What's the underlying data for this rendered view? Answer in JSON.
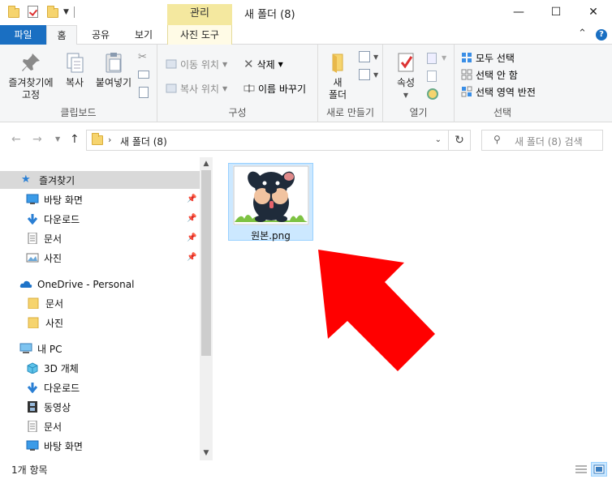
{
  "titlebar": {
    "manage_tab": "관리",
    "window_title": "새 폴더 (8)",
    "minimize": "—",
    "maximize": "☐",
    "close": "✕"
  },
  "tabs": {
    "file": "파일",
    "home": "홈",
    "share": "공유",
    "view": "보기",
    "picture_tools": "사진 도구"
  },
  "ribbon": {
    "clipboard": {
      "pin_label": "즐겨찾기에\n고정",
      "pin_l1": "즐겨찾기에",
      "pin_l2": "고정",
      "copy": "복사",
      "paste": "붙여넣기",
      "group": "클립보드"
    },
    "organize": {
      "move_to": "이동 위치",
      "copy_to": "복사 위치",
      "delete": "삭제",
      "rename": "이름 바꾸기",
      "group": "구성"
    },
    "new": {
      "new_folder_l1": "새",
      "new_folder_l2": "폴더",
      "group": "새로 만들기"
    },
    "open": {
      "properties": "속성",
      "group": "열기"
    },
    "select": {
      "select_all": "모두 선택",
      "select_none": "선택 안 함",
      "invert": "선택 영역 반전",
      "group": "선택"
    }
  },
  "address": {
    "path": "새 폴더 (8)",
    "search_placeholder": "새 폴더 (8) 검색"
  },
  "nav": {
    "quick_access": "즐겨찾기",
    "desktop": "바탕 화면",
    "downloads": "다운로드",
    "documents": "문서",
    "pictures": "사진",
    "onedrive": "OneDrive - Personal",
    "od_documents": "문서",
    "od_pictures": "사진",
    "this_pc": "내 PC",
    "objects3d": "3D 개체",
    "pc_downloads": "다운로드",
    "videos": "동영상",
    "pc_documents": "문서",
    "pc_desktop": "바탕 화면"
  },
  "files": [
    {
      "name": "원본.png"
    }
  ],
  "status": {
    "item_count": "1개 항목"
  },
  "colors": {
    "file_tab": "#1a6fc2",
    "manage_tab": "#f4e89f",
    "selection": "#cce8ff",
    "arrow": "#ff0000"
  }
}
